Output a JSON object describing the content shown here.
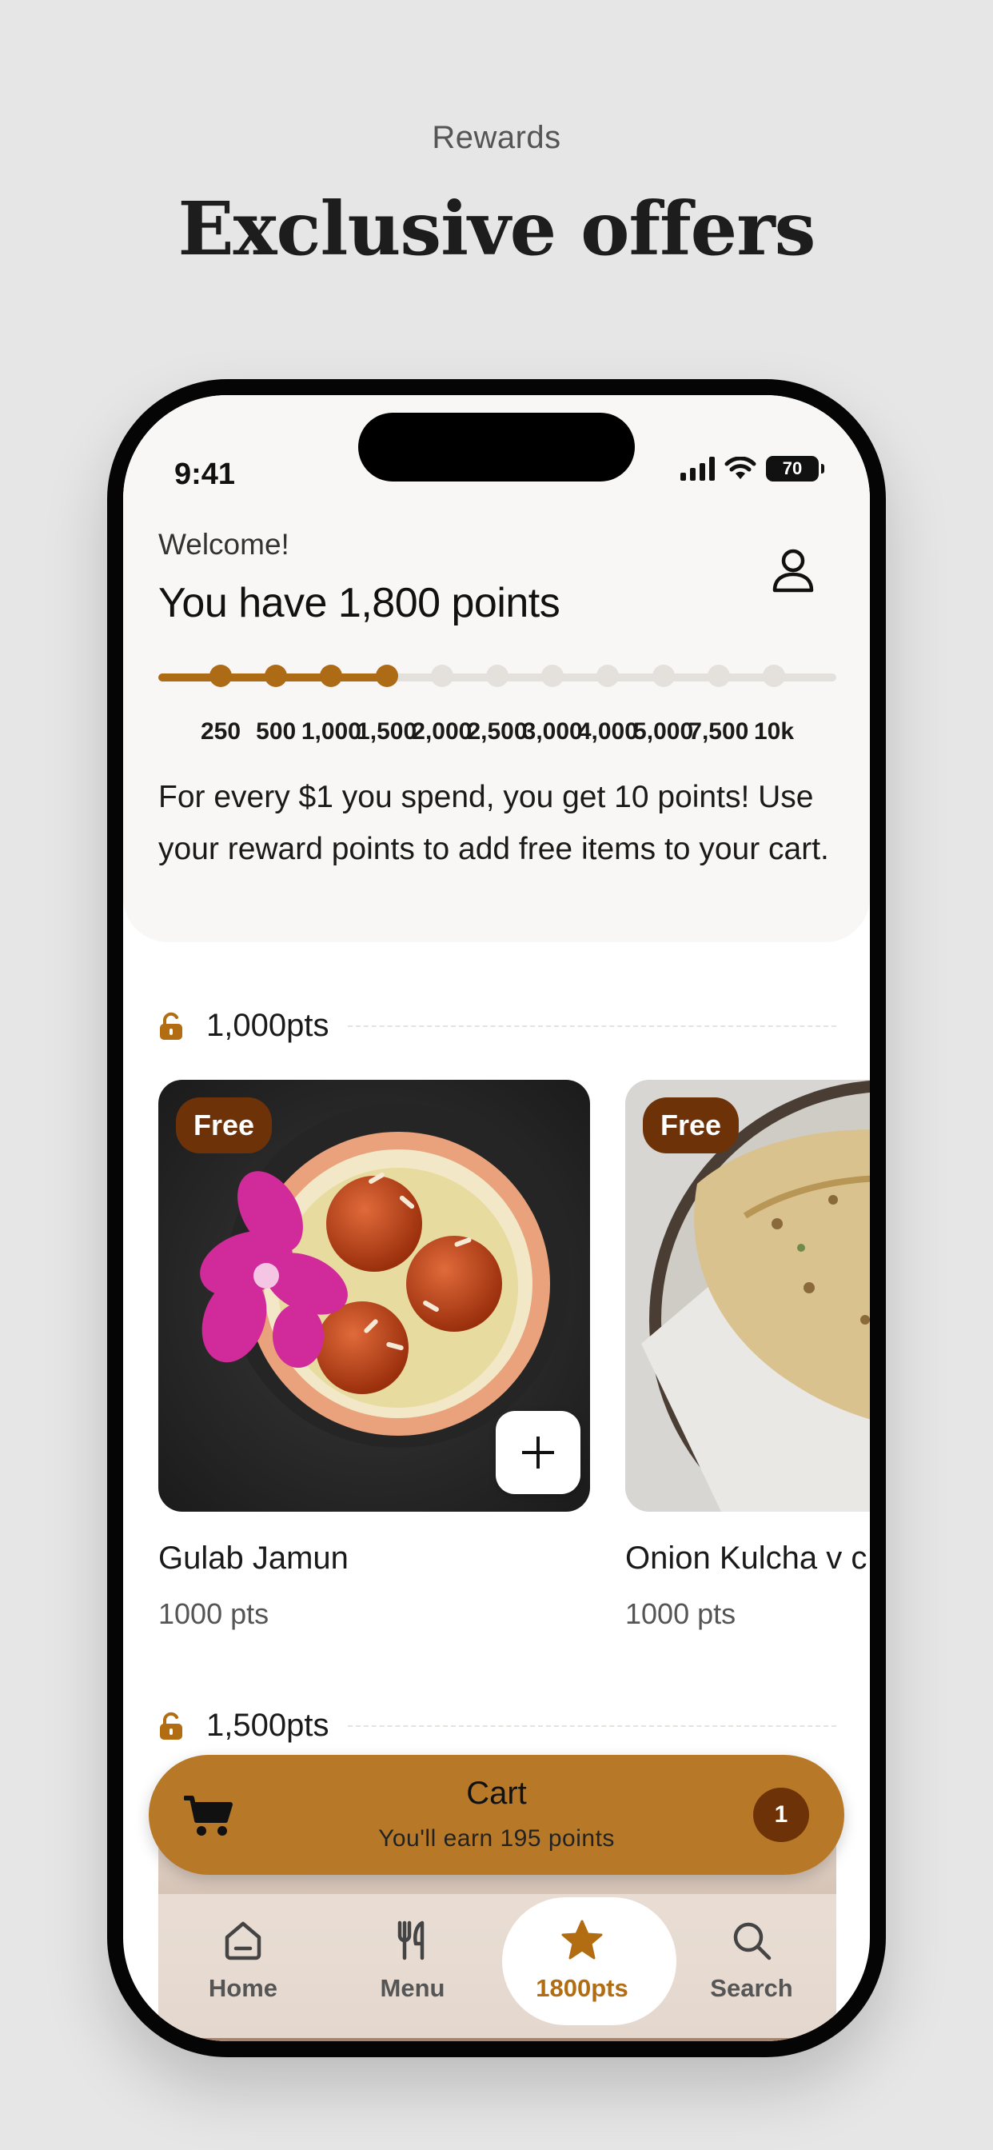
{
  "promo": {
    "kicker": "Rewards",
    "title": "Exclusive offers"
  },
  "status_bar": {
    "time": "9:41",
    "battery": "70"
  },
  "header": {
    "welcome": "Welcome!",
    "points_title": "You have 1,800 points",
    "profile_icon": "person-icon"
  },
  "progress": {
    "current_points": 1800,
    "tiers": [
      "250",
      "500",
      "1,000",
      "1,500",
      "2,000",
      "2,500",
      "3,000",
      "4,000",
      "5,000",
      "7,500",
      "10k"
    ],
    "tiers_unlocked": 4,
    "accent_color": "#ad6b16"
  },
  "rules": {
    "text": "For every $1 you spend, you get 10 points! Use your reward points to add free items to your cart."
  },
  "sections": [
    {
      "label": "1,000pts",
      "icon": "unlocked-lock-icon",
      "items": [
        {
          "badge": "Free",
          "name": "Gulab Jamun",
          "points": "1000 pts",
          "add_icon": "plus-icon"
        },
        {
          "badge": "Free",
          "name": "Onion Kulcha v c",
          "points": "1000 pts"
        }
      ]
    },
    {
      "label": "1,500pts",
      "icon": "unlocked-lock-icon"
    }
  ],
  "cart": {
    "title": "Cart",
    "subtitle": "You'll earn 195 points",
    "count": "1",
    "icon": "cart-icon"
  },
  "tabs": [
    {
      "label": "Home",
      "icon": "home-icon"
    },
    {
      "label": "Menu",
      "icon": "utensils-icon"
    },
    {
      "label": "1800pts",
      "icon": "star-icon",
      "active": true
    },
    {
      "label": "Search",
      "icon": "search-icon"
    }
  ]
}
